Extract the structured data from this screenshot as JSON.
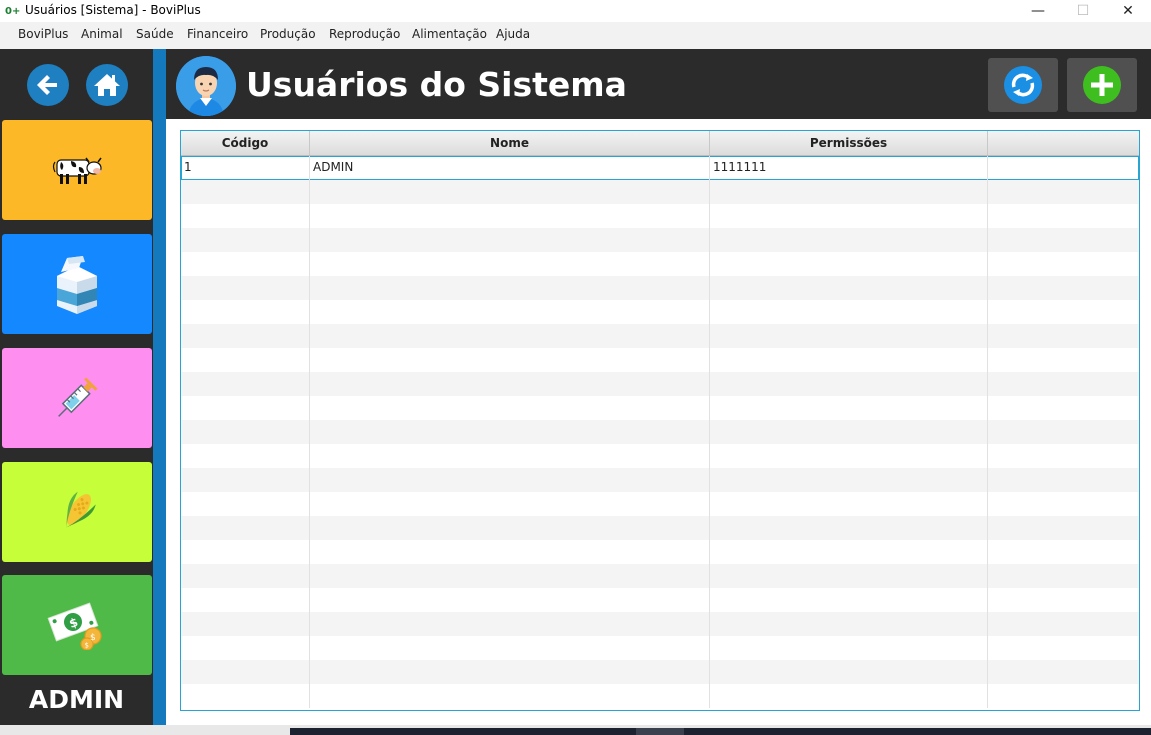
{
  "window": {
    "title": "Usuários [Sistema] - BoviPlus",
    "minimize": "—",
    "maximize": "☐",
    "close": "✕"
  },
  "menu": [
    "BoviPlus",
    "Animal",
    "Saúde",
    "Financeiro",
    "Produção",
    "Reprodução",
    "Alimentação",
    "Ajuda"
  ],
  "sidebar": {
    "tiles": [
      {
        "name": "animal",
        "icon": "cow-icon",
        "color": "#fdb827"
      },
      {
        "name": "producao",
        "icon": "milk-carton-icon",
        "color": "#1388ff"
      },
      {
        "name": "saude",
        "icon": "syringe-icon",
        "color": "#ff8ef1"
      },
      {
        "name": "alimentacao",
        "icon": "corn-icon",
        "color": "#c6ff39"
      },
      {
        "name": "financeiro",
        "icon": "money-icon",
        "color": "#4fba47"
      }
    ],
    "user_label": "ADMIN"
  },
  "header": {
    "title": "Usuários do Sistema"
  },
  "table": {
    "columns": [
      "Código",
      "Nome",
      "Permissões",
      ""
    ],
    "rows": [
      [
        "1",
        "ADMIN",
        "1111111",
        ""
      ]
    ]
  },
  "colors": {
    "dark": "#2b2b2b",
    "accent_blue": "#1479bd",
    "table_border": "#29a3d1"
  }
}
